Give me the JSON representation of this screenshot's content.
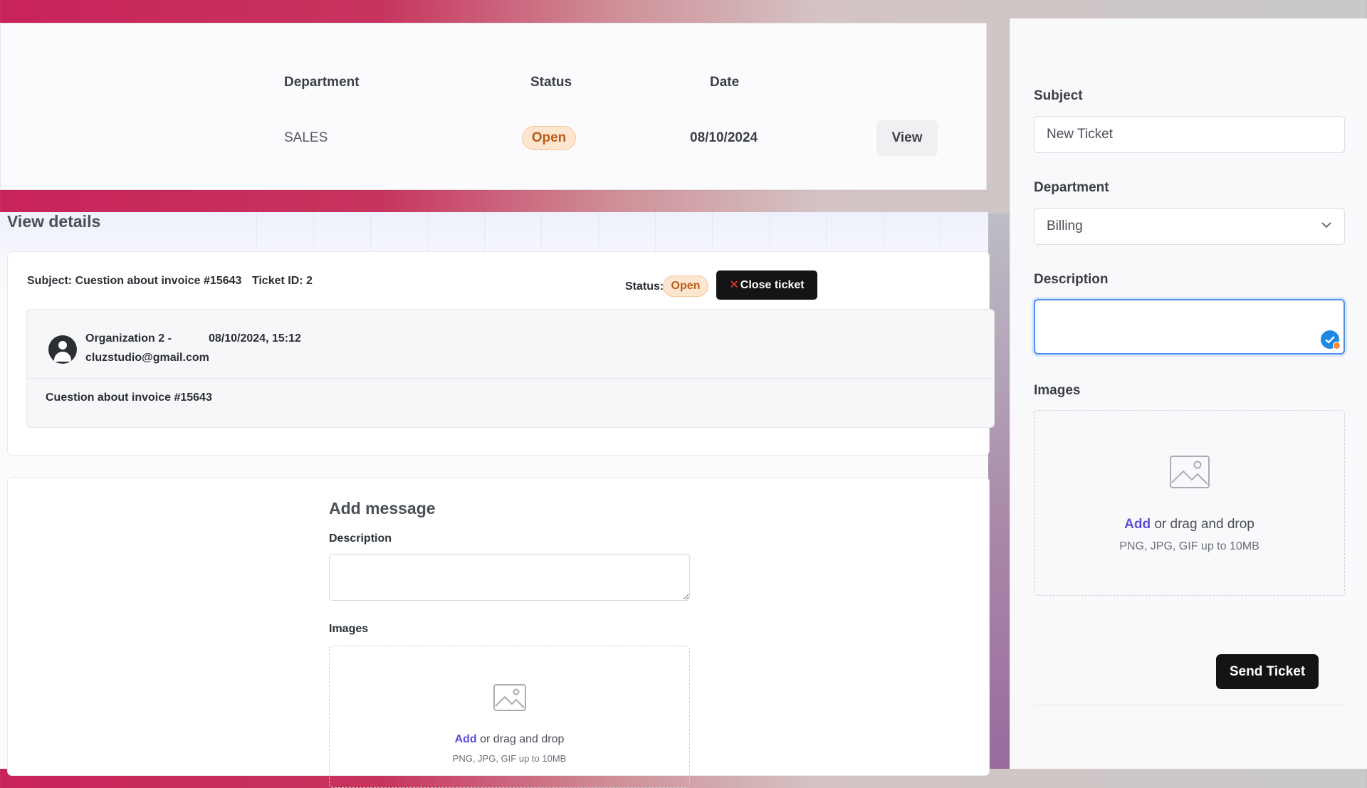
{
  "tickets_table": {
    "headers": {
      "department": "Department",
      "status": "Status",
      "date": "Date"
    },
    "row": {
      "department": "SALES",
      "status": "Open",
      "date": "08/10/2024",
      "action": "View"
    }
  },
  "detail": {
    "title": "View details",
    "subject": "Subject: Cuestion about invoice #15643",
    "ticket_id": "Ticket ID: 2",
    "status_label": "Status:",
    "status_value": "Open",
    "close_button": "Close ticket",
    "message": {
      "author": "Organization 2 -",
      "email": "cluzstudio@gmail.com",
      "datetime": "08/10/2024, 15:12",
      "text": "Cuestion about invoice #15643"
    }
  },
  "add_message": {
    "title": "Add message",
    "description_label": "Description",
    "description_value": "",
    "images_label": "Images",
    "drop_add": "Add",
    "drop_text": " or drag and drop",
    "drop_hint": "PNG, JPG, GIF up to 10MB"
  },
  "new_ticket_form": {
    "subject_label": "Subject",
    "subject_value": "New Ticket",
    "department_label": "Department",
    "department_value": "Billing",
    "description_label": "Description",
    "description_value": "",
    "images_label": "Images",
    "drop_add": "Add",
    "drop_text": " or drag and drop",
    "drop_hint": "PNG, JPG, GIF up to 10MB",
    "submit": "Send Ticket"
  },
  "icons": {
    "close": "x-icon",
    "avatar": "user-avatar-icon",
    "image": "image-icon",
    "chevron": "chevron-down-icon",
    "check": "check-circle-icon"
  },
  "colors": {
    "badge_bg": "#fde6cf",
    "badge_text": "#b85c19",
    "primary_button": "#141414",
    "link": "#5b4fd6",
    "focus": "#4d8ef5"
  }
}
